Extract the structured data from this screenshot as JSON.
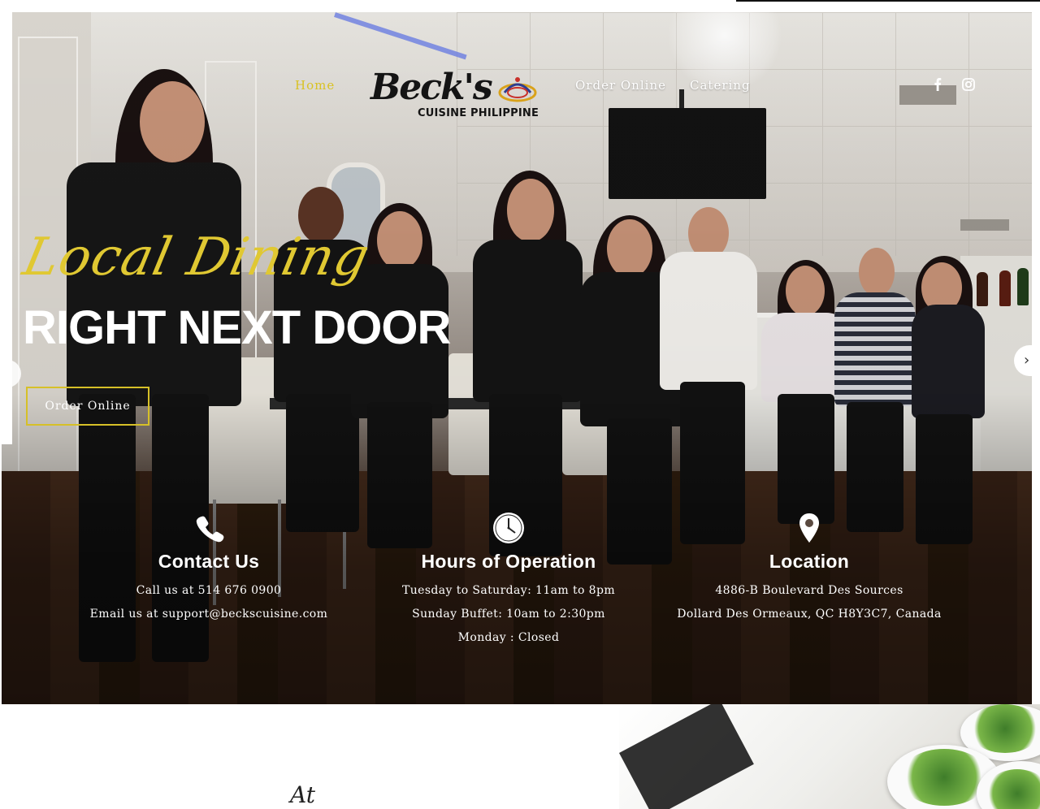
{
  "nav": {
    "home": "Home",
    "order_online": "Order Online",
    "catering": "Catering"
  },
  "logo": {
    "script": "Beck's",
    "subtitle": "CUISINE PHILIPPINE"
  },
  "social": {
    "facebook_icon": "facebook-icon",
    "instagram_icon": "instagram-icon"
  },
  "hero": {
    "script_title": "Local Dining",
    "title": "RIGHT NEXT DOOR",
    "cta": "Order Online"
  },
  "contact": {
    "title": "Contact Us",
    "phone": "Call us at 514 676 0900",
    "email": "Email us at support@beckscuisine.com"
  },
  "hours": {
    "title": "Hours of Operation",
    "line1": "Tuesday to Saturday: 11am to 8pm",
    "line2": "Sunday Buffet: 10am to 2:30pm",
    "line3": "Monday : Closed"
  },
  "location": {
    "title": "Location",
    "line1": "4886-B Boulevard Des Sources",
    "line2": "Dollard Des Ormeaux, QC H8Y3C7, Canada"
  },
  "below": {
    "script": "At"
  },
  "colors": {
    "accent": "#d9c222",
    "text_light": "#ffffff"
  }
}
